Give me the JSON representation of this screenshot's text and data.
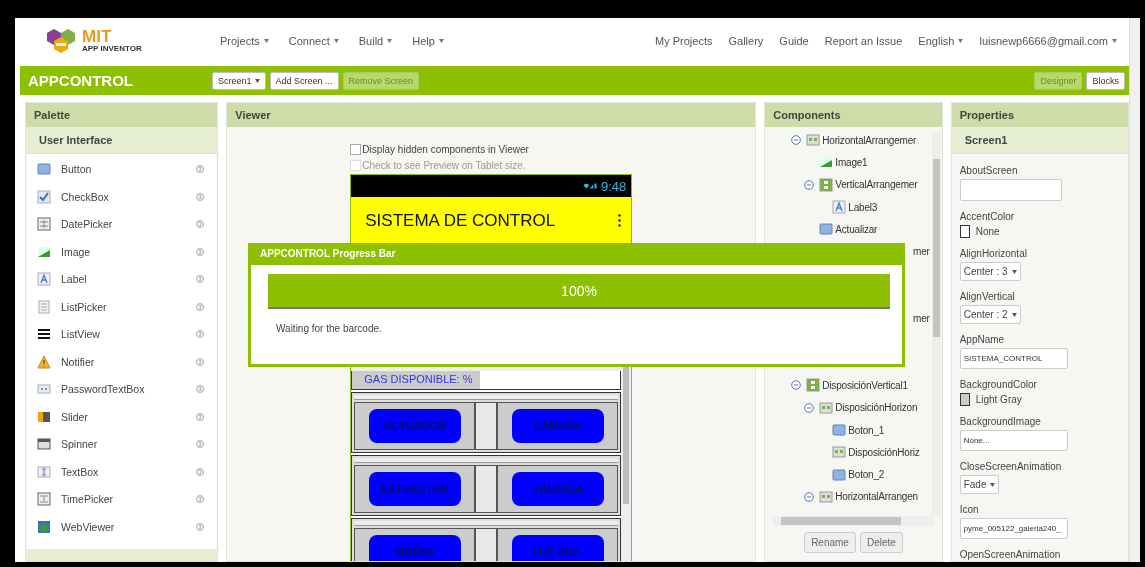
{
  "header": {
    "logo": {
      "title": "MIT",
      "subtitle": "APP INVENTOR"
    },
    "menus": [
      {
        "label": "Projects",
        "dropdown": true
      },
      {
        "label": "Connect",
        "dropdown": true
      },
      {
        "label": "Build",
        "dropdown": true
      },
      {
        "label": "Help",
        "dropdown": true
      }
    ],
    "links": [
      {
        "label": "My Projects",
        "dropdown": false
      },
      {
        "label": "Gallery",
        "dropdown": false
      },
      {
        "label": "Guide",
        "dropdown": false
      },
      {
        "label": "Report an Issue",
        "dropdown": false
      },
      {
        "label": "English",
        "dropdown": true
      },
      {
        "label": "luisnewp6666@gmail.com",
        "dropdown": true
      }
    ]
  },
  "toolbar": {
    "project": "APPCONTROL",
    "screen_buttons": [
      {
        "label": "Screen1",
        "dropdown": true,
        "disabled": false
      },
      {
        "label": "Add Screen ...",
        "dropdown": false,
        "disabled": false
      },
      {
        "label": "Remove Screen",
        "dropdown": false,
        "disabled": true
      }
    ],
    "views": [
      {
        "label": "Designer",
        "selected": true
      },
      {
        "label": "Blocks",
        "selected": false
      }
    ]
  },
  "palette": {
    "title": "Palette",
    "section": "User Interface",
    "items": [
      {
        "name": "Button",
        "kind": "button"
      },
      {
        "name": "CheckBox",
        "kind": "checkbox"
      },
      {
        "name": "DatePicker",
        "kind": "datepicker"
      },
      {
        "name": "Image",
        "kind": "image"
      },
      {
        "name": "Label",
        "kind": "label"
      },
      {
        "name": "ListPicker",
        "kind": "listpicker"
      },
      {
        "name": "ListView",
        "kind": "listview"
      },
      {
        "name": "Notifier",
        "kind": "notifier"
      },
      {
        "name": "PasswordTextBox",
        "kind": "password"
      },
      {
        "name": "Slider",
        "kind": "slider"
      },
      {
        "name": "Spinner",
        "kind": "spinner"
      },
      {
        "name": "TextBox",
        "kind": "textbox"
      },
      {
        "name": "TimePicker",
        "kind": "timepicker"
      },
      {
        "name": "WebViewer",
        "kind": "webviewer"
      }
    ]
  },
  "viewer": {
    "title": "Viewer",
    "options": [
      {
        "label": "Display hidden components in Viewer",
        "checked": false,
        "disabled": false
      },
      {
        "label": "Check to see Preview on Tablet size.",
        "checked": false,
        "disabled": true
      }
    ],
    "phone": {
      "time": "9:48",
      "title": "SISTEMA DE CONTROL",
      "gas_label": "GAS DISPONIBLE: %",
      "button_rows": [
        [
          "ACTUADOR",
          "CÁMARA"
        ],
        [
          "EXTRACTOR",
          "VÁLVULA"
        ],
        [
          "SIRENA",
          "LUZ AUX."
        ]
      ]
    }
  },
  "components": {
    "title": "Components",
    "tree": [
      {
        "label": "HorizontalArrangemer",
        "kind": "arrangement-h",
        "expanded": true,
        "children": [
          {
            "label": "Image1",
            "kind": "image"
          },
          {
            "label": "VerticalArrangemer",
            "kind": "arrangement-v",
            "expanded": true,
            "children": [
              {
                "label": "Label3",
                "kind": "label"
              }
            ]
          },
          {
            "label": "Actualizar",
            "kind": "button"
          }
        ]
      },
      {
        "kind": "covered",
        "label": "mer"
      },
      {
        "kind": "covered"
      },
      {
        "kind": "covered"
      },
      {
        "kind": "covered",
        "label": "mer"
      },
      {
        "kind": "covered"
      },
      {
        "kind": "covered"
      },
      {
        "label": "DisposiciónVertical1",
        "kind": "arrangement-v",
        "expanded": true,
        "children": [
          {
            "label": "DisposiciónHorizon",
            "kind": "arrangement-h",
            "expanded": true,
            "children": [
              {
                "label": "Boton_1",
                "kind": "button"
              },
              {
                "label": "DisposiciónHoriz",
                "kind": "arrangement-h"
              },
              {
                "label": "Boton_2",
                "kind": "button"
              }
            ]
          },
          {
            "label": "HorizontalArrangen",
            "kind": "arrangement-h",
            "expanded": true
          }
        ]
      }
    ],
    "buttons": [
      "Rename",
      "Delete"
    ]
  },
  "properties": {
    "title": "Properties",
    "component": "Screen1",
    "items": [
      {
        "name": "AboutScreen",
        "kind": "textarea"
      },
      {
        "name": "AccentColor",
        "kind": "color",
        "value": "None",
        "color": "#ffffff"
      },
      {
        "name": "AlignHorizontal",
        "kind": "dropdown",
        "value": "Center : 3"
      },
      {
        "name": "AlignVertical",
        "kind": "dropdown",
        "value": "Center : 2"
      },
      {
        "name": "AppName",
        "kind": "text",
        "value": "SISTEMA_CONTROL"
      },
      {
        "name": "BackgroundColor",
        "kind": "color",
        "value": "Light Gray",
        "color": "#cccccc"
      },
      {
        "name": "BackgroundImage",
        "kind": "text",
        "value": "None..."
      },
      {
        "name": "CloseScreenAnimation",
        "kind": "dropdown",
        "value": "Fade"
      },
      {
        "name": "Icon",
        "kind": "text",
        "value": "pyme_005122_galeria240_"
      },
      {
        "name": "OpenScreenAnimation",
        "kind": "cut"
      }
    ]
  },
  "dialog": {
    "title": "APPCONTROL Progress Bar",
    "level": 1,
    "reading": "100%",
    "message": "Waiting for the barcode."
  }
}
